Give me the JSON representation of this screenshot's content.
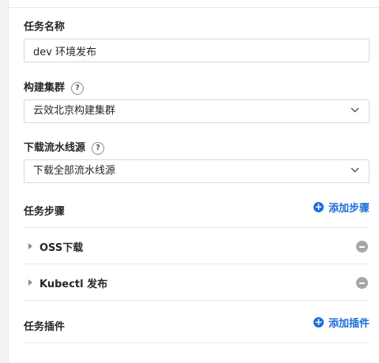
{
  "form": {
    "task_name": {
      "label": "任务名称",
      "value": "dev 环境发布"
    },
    "cluster": {
      "label": "构建集群",
      "selected": "云效北京构建集群"
    },
    "source": {
      "label": "下载流水线源",
      "selected": "下载全部流水线源"
    }
  },
  "steps": {
    "title": "任务步骤",
    "add_label": "添加步骤",
    "items": [
      {
        "name": "OSS下载"
      },
      {
        "name": "Kubectl 发布"
      }
    ]
  },
  "plugins": {
    "title": "任务插件",
    "add_label": "添加插件"
  },
  "colors": {
    "accent": "#1b6dd8",
    "remove": "#a6a6a6"
  },
  "icons": {
    "help": "question-circle-icon",
    "add": "plus-circle-icon",
    "expand": "caret-right-icon",
    "remove": "minus-circle-icon",
    "dropdown": "chevron-down-icon"
  }
}
